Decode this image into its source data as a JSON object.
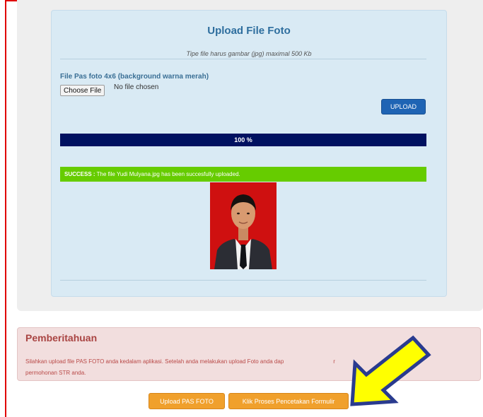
{
  "panel": {
    "title": "Upload File Foto",
    "hint": "Tipe file harus gambar (jpg) maximal 500 Kb",
    "field_label": "File Pas foto 4x6 (background warna merah)",
    "choose_file_label": "Choose File",
    "file_status": "No file chosen",
    "upload_label": "UPLOAD",
    "progress_text": "100 %",
    "progress_value": 1.0,
    "success_prefix": "SUCCESS :",
    "success_message": "The file Yudi Mulyana.jpg has been succesfully uploaded."
  },
  "notice": {
    "title": "Pemberitahuan",
    "text_line1": "Silahkan upload file PAS FOTO anda kedalam aplikasi. Setelah anda melakukan upload Foto anda dap",
    "text_line1_tail": "r",
    "text_line2": "permohonan STR anda."
  },
  "actions": {
    "upload_photo_label": "Upload PAS FOTO",
    "print_form_label": "Klik Proses Pencetakan Formulir"
  },
  "colors": {
    "accent_blue": "#1f64b4",
    "success_green": "#66cc00",
    "progress_navy": "#0a1a6e",
    "orange": "#f0a02c",
    "annotation_arrow": "#ffff00"
  }
}
